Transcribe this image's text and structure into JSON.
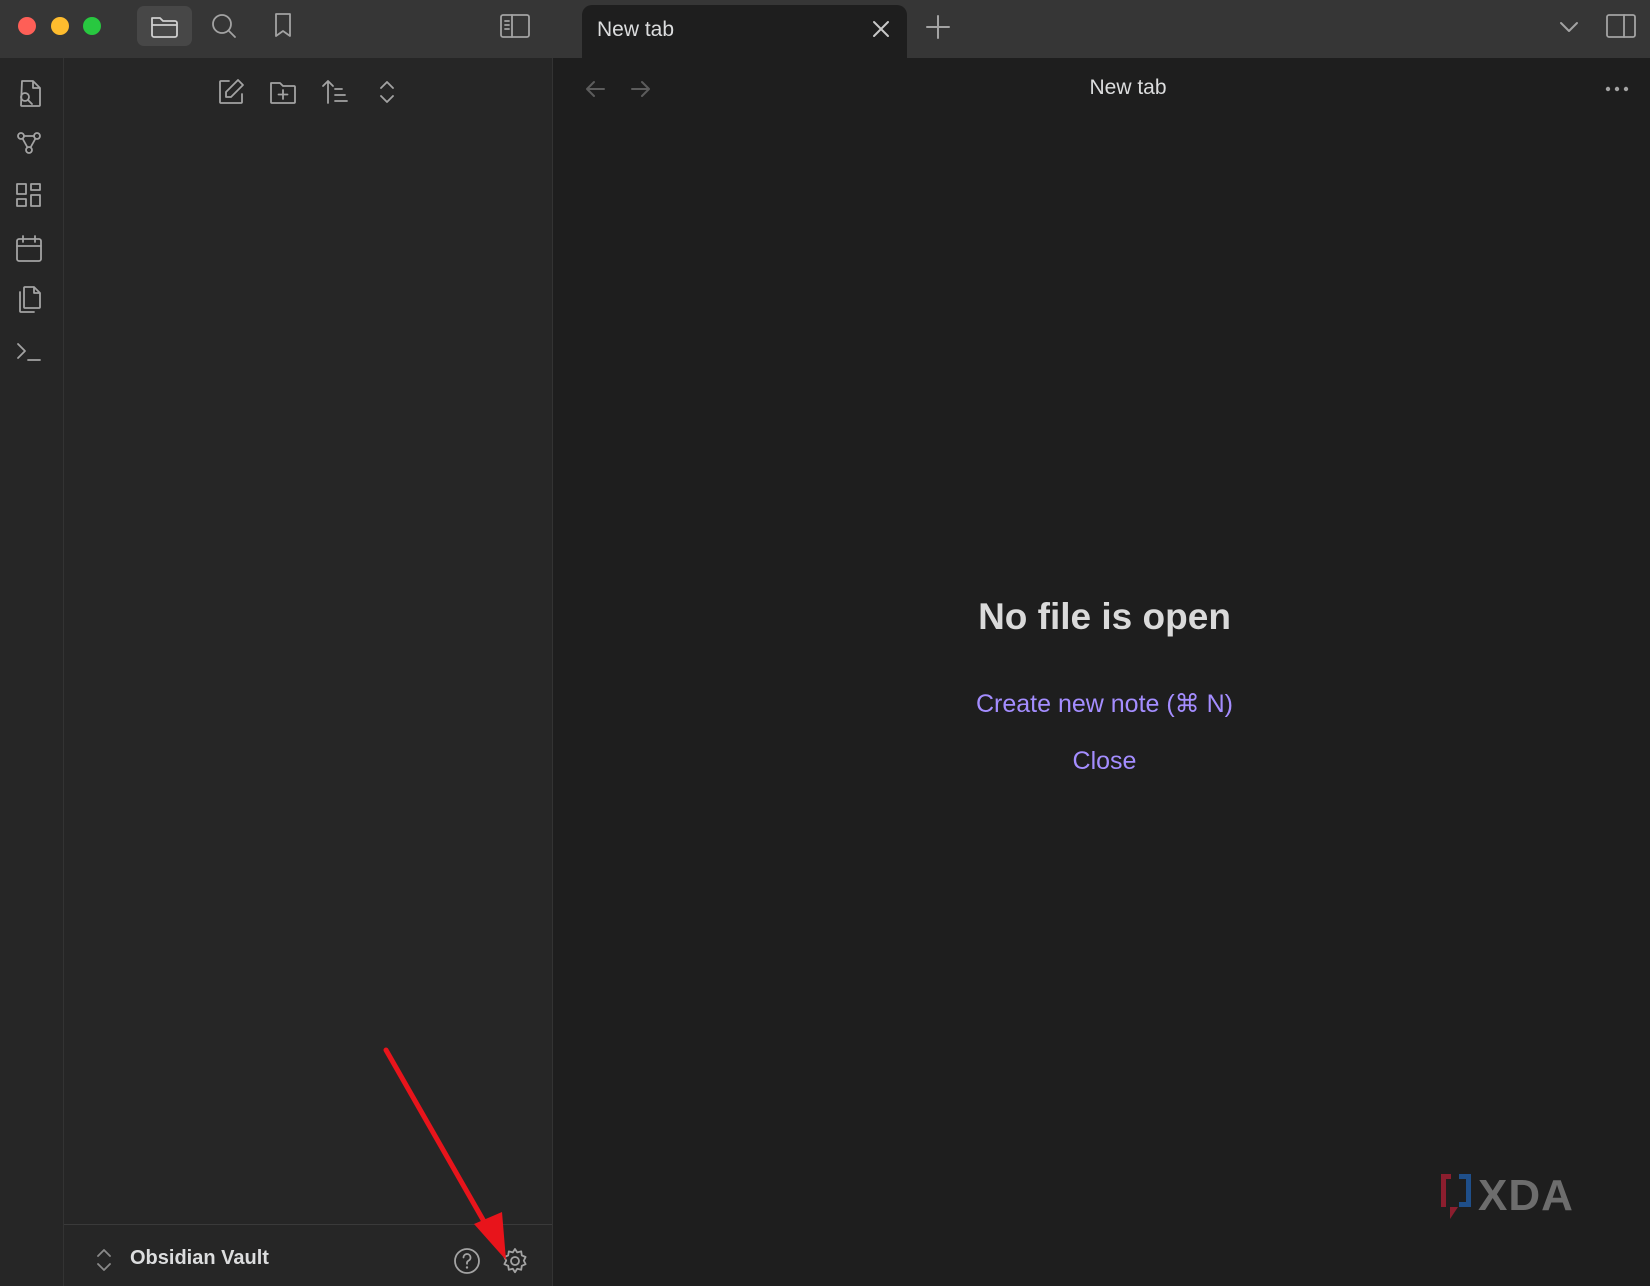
{
  "window": {
    "tab_title": "New tab",
    "view_title": "New tab"
  },
  "icons": {
    "titlebar": [
      "files-icon",
      "search-icon",
      "bookmark-icon",
      "sidebar-toggle-icon",
      "close-icon",
      "plus-icon",
      "chevron-down-icon",
      "right-sidebar-icon"
    ],
    "ribbon": [
      "quick-switcher-icon",
      "graph-view-icon",
      "canvas-icon",
      "daily-note-icon",
      "templates-icon",
      "command-palette-icon"
    ],
    "explorer_toolbar": [
      "new-note-icon",
      "new-folder-icon",
      "sort-icon",
      "collapse-icon"
    ]
  },
  "sidebar": {
    "vault_name": "Obsidian Vault"
  },
  "main": {
    "empty_title": "No file is open",
    "create_link": "Create new note (⌘ N)",
    "close_link": "Close"
  },
  "watermark": {
    "text": "XDA"
  },
  "colors": {
    "accent": "#a48dff",
    "arrow": "#e8141b",
    "traffic_red": "#fe5f57",
    "traffic_yellow": "#febc2e",
    "traffic_green": "#28c840"
  }
}
